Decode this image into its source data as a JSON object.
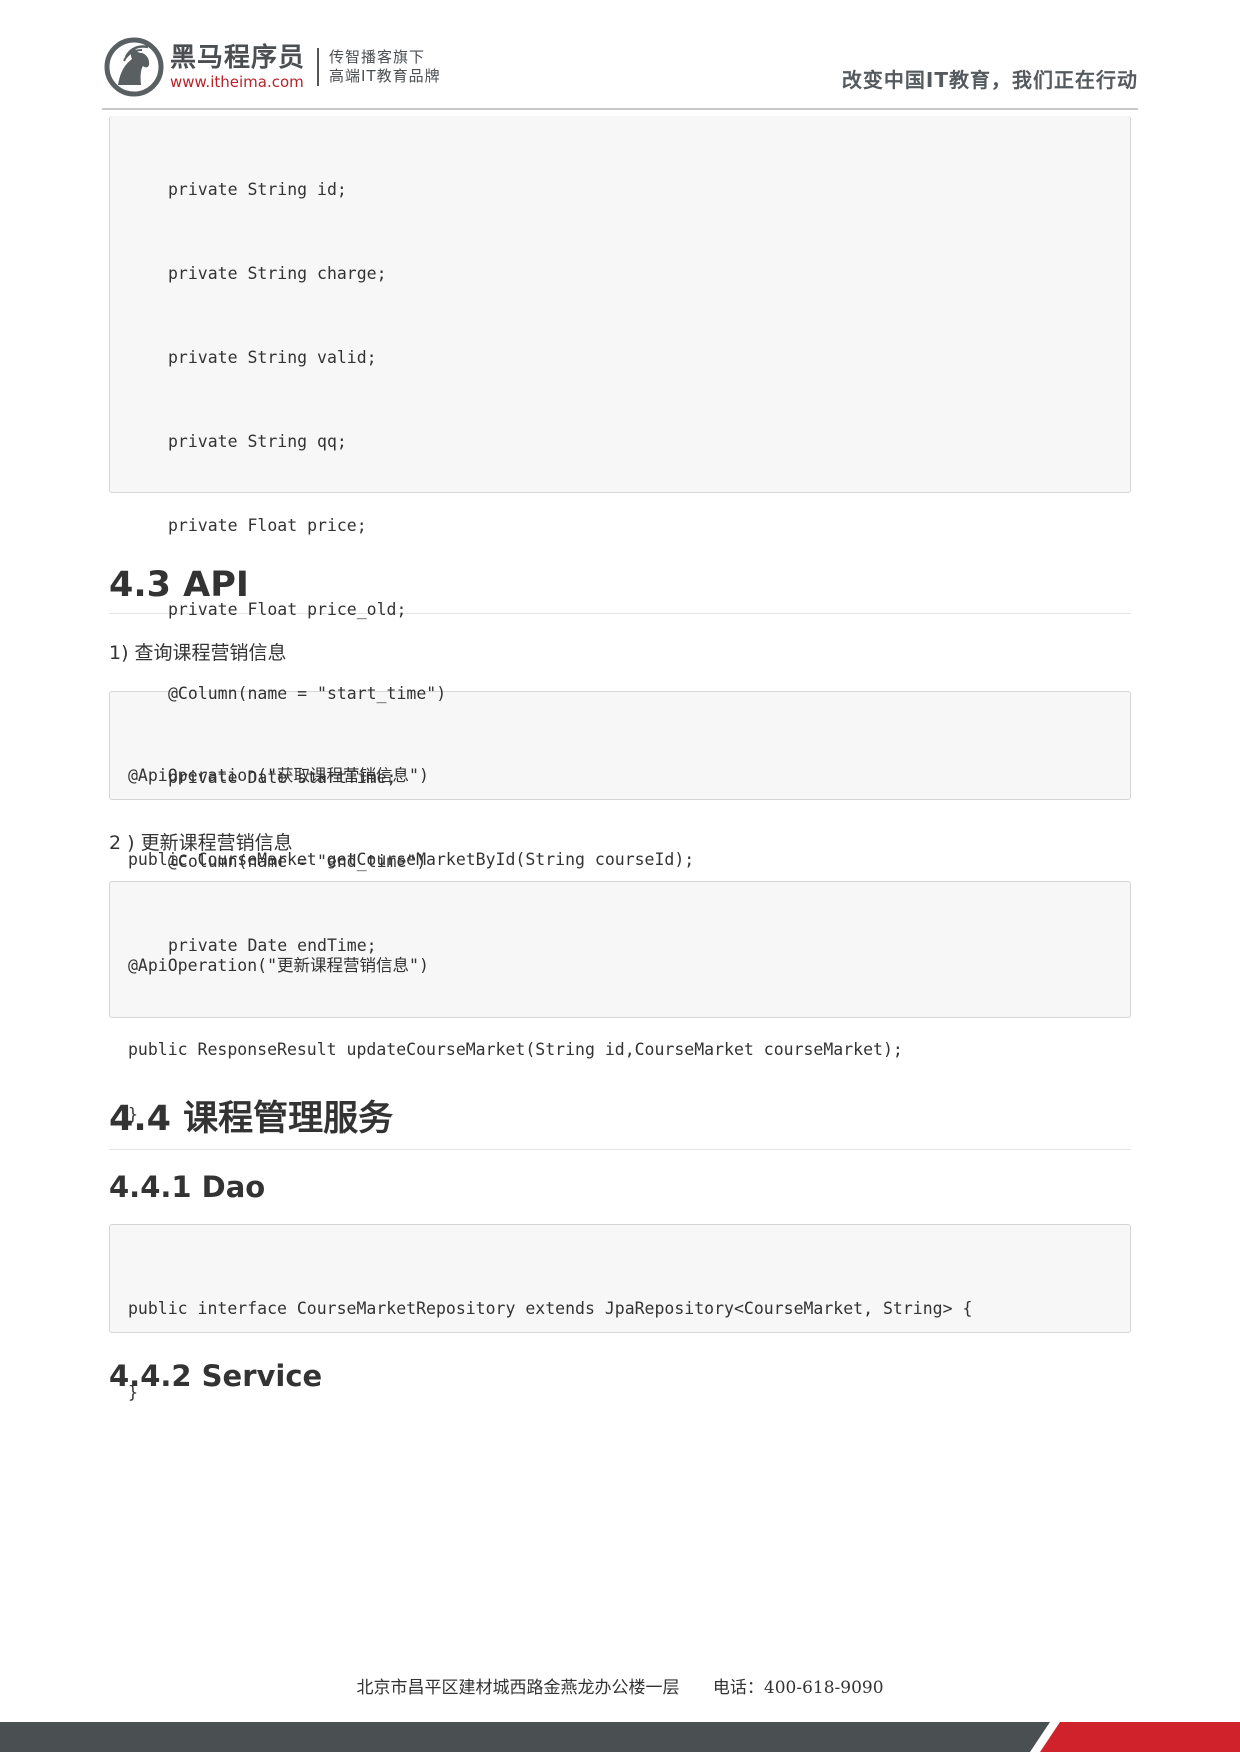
{
  "header": {
    "brand_name": "黑马程序员",
    "brand_url": "www.itheima.com",
    "brand_sub_line1": "传智播客旗下",
    "brand_sub_line2": "高端IT教育品牌",
    "slogan": "改变中国IT教育，我们正在行动",
    "logo_icon": "horse-head-icon"
  },
  "code_block_1": {
    "lines": [
      "private String id;",
      "private String charge;",
      "private String valid;",
      "private String qq;",
      "private Float price;",
      "private Float price_old;",
      "@Column(name = \"start_time\")",
      "private Date startTime;",
      "@Column(name = \"end_time\")",
      "private Date endTime;"
    ],
    "closing": "}"
  },
  "section_43": {
    "heading": "4.3 API",
    "item1": "1) 查询课程营销信息",
    "code1": [
      "@ApiOperation(\"获取课程营销信息\")",
      "public CourseMarket getCourseMarketById(String courseId);"
    ],
    "item2": "2 ) 更新课程营销信息",
    "code2": [
      "@ApiOperation(\"更新课程营销信息\")",
      "public ResponseResult updateCourseMarket(String id,CourseMarket courseMarket);"
    ]
  },
  "section_44": {
    "heading": "4.4 课程管理服务",
    "sub1": "4.4.1 Dao",
    "code": [
      "public interface CourseMarketRepository extends JpaRepository<CourseMarket, String> {",
      "}"
    ],
    "sub2": "4.4.2 Service"
  },
  "footer": {
    "address": "北京市昌平区建材城西路金燕龙办公楼一层",
    "phone": "电话：400-618-9090"
  },
  "colors": {
    "brand_red": "#d0222b",
    "dark_gray": "#4a5052",
    "code_bg": "#f7f7f7"
  }
}
